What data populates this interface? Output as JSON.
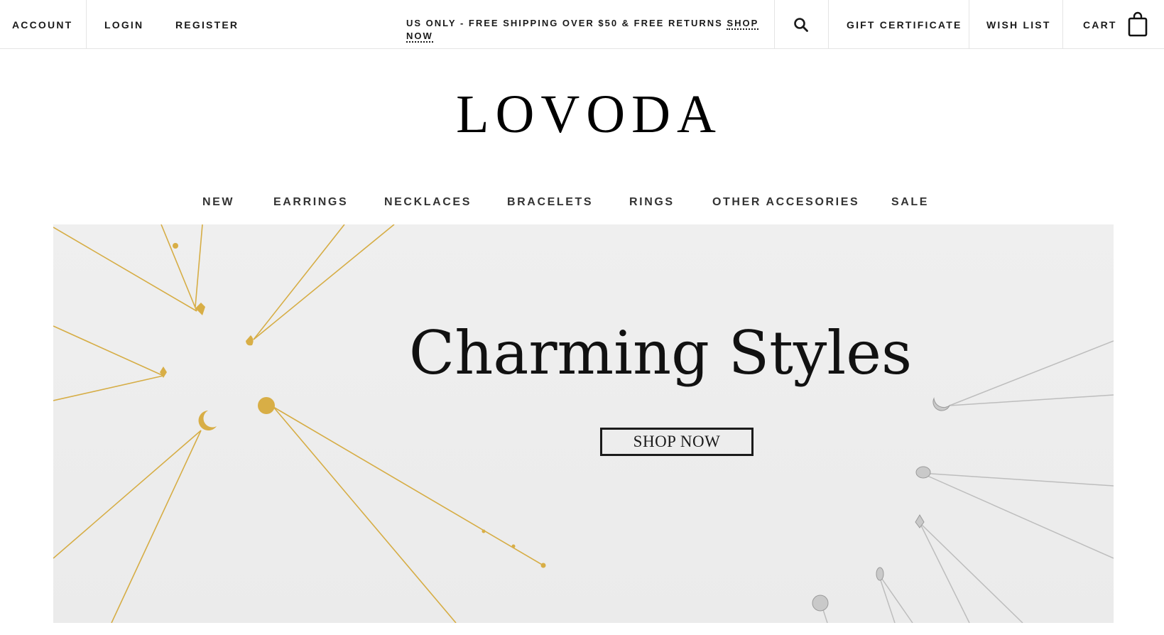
{
  "topbar": {
    "account": "ACCOUNT",
    "login": "LOGIN",
    "register": "REGISTER",
    "promo_text": "US ONLY - FREE SHIPPING OVER $50 & FREE RETURNS ",
    "promo_link": "SHOP NOW",
    "gift_certificate": "GIFT CERTIFICATE",
    "wish_list": "WISH LIST",
    "cart": "CART",
    "search_icon": "search-icon",
    "cart_icon": "shopping-bag-icon"
  },
  "brand": {
    "logo": "LOVODA"
  },
  "nav": [
    {
      "label": "NEW"
    },
    {
      "label": "EARRINGS"
    },
    {
      "label": "NECKLACES"
    },
    {
      "label": "BRACELETS"
    },
    {
      "label": "RINGS"
    },
    {
      "label": "OTHER ACCESORIES"
    },
    {
      "label": "SALE"
    }
  ],
  "hero": {
    "headline": "Charming Styles",
    "cta": "SHOP NOW",
    "colors": {
      "background": "#ededed",
      "gold": "#d4a93c",
      "silver": "#b8b8b8"
    }
  }
}
